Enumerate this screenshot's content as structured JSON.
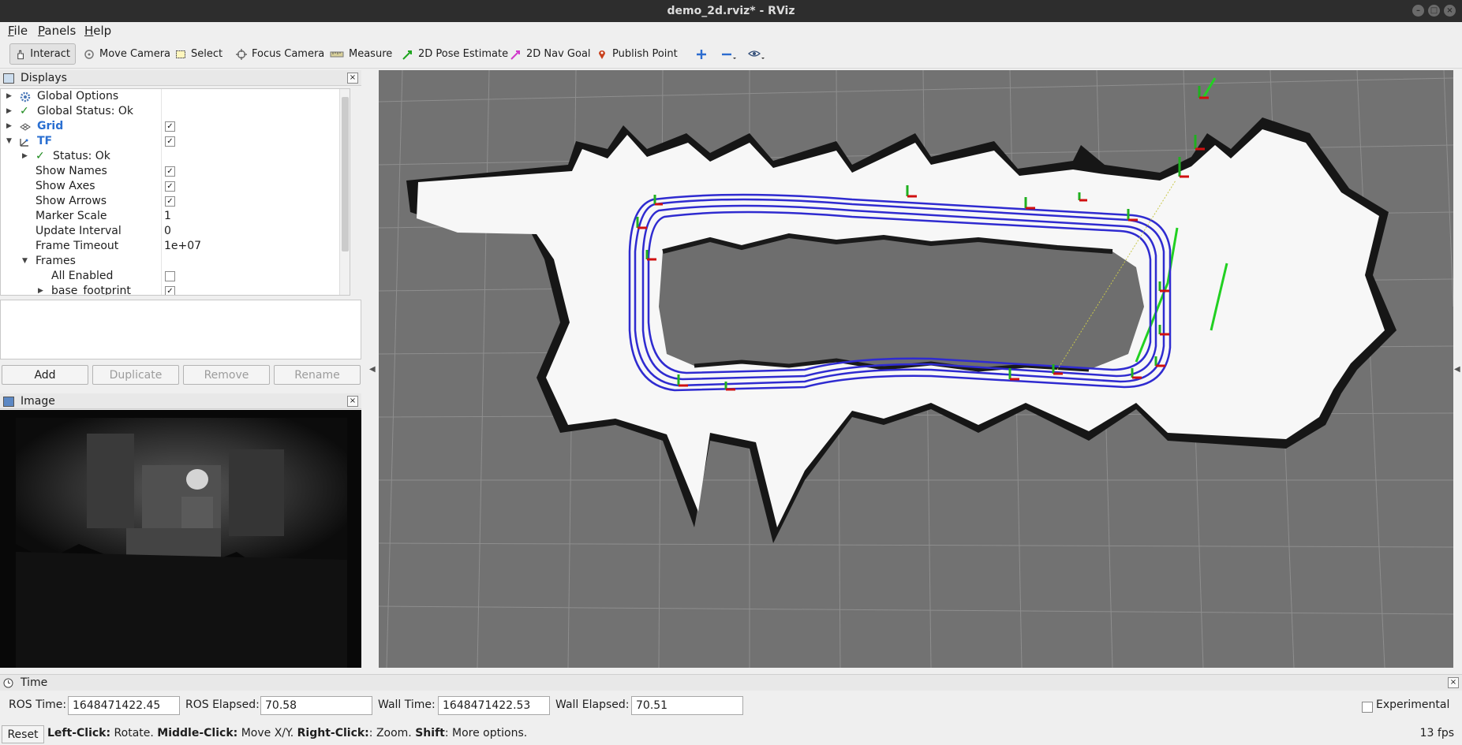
{
  "window": {
    "title": "demo_2d.rviz* - RViz"
  },
  "menu": [
    {
      "label": "File",
      "mnemonic": "F",
      "rest": "ile"
    },
    {
      "label": "Panels",
      "mnemonic": "P",
      "rest": "anels"
    },
    {
      "label": "Help",
      "mnemonic": "H",
      "rest": "elp"
    }
  ],
  "toolbar": {
    "interact": "Interact",
    "move_camera": "Move Camera",
    "select": "Select",
    "focus_camera": "Focus Camera",
    "measure": "Measure",
    "pose_estimate": "2D Pose Estimate",
    "nav_goal": "2D Nav Goal",
    "publish_point": "Publish Point"
  },
  "displays": {
    "title": "Displays",
    "rows": [
      {
        "label": "Global Options",
        "value": ""
      },
      {
        "label": "Global Status: Ok",
        "value": ""
      },
      {
        "label": "Grid",
        "value": ""
      },
      {
        "label": "TF",
        "value": ""
      },
      {
        "label": "Status: Ok",
        "value": ""
      },
      {
        "label": "Show Names",
        "value": ""
      },
      {
        "label": "Show Axes",
        "value": ""
      },
      {
        "label": "Show Arrows",
        "value": ""
      },
      {
        "label": "Marker Scale",
        "value": "1"
      },
      {
        "label": "Update Interval",
        "value": "0"
      },
      {
        "label": "Frame Timeout",
        "value": "1e+07"
      },
      {
        "label": "Frames",
        "value": ""
      },
      {
        "label": "All Enabled",
        "value": ""
      },
      {
        "label": "base_footprint",
        "value": ""
      }
    ],
    "checkboxes": {
      "grid": true,
      "tf": true,
      "show_names": true,
      "show_axes": true,
      "show_arrows": true,
      "all_enabled": false,
      "base_footprint": true
    },
    "buttons": {
      "add": "Add",
      "duplicate": "Duplicate",
      "remove": "Remove",
      "rename": "Rename"
    }
  },
  "image_panel": {
    "title": "Image"
  },
  "time_panel": {
    "title": "Time",
    "ros_time_label": "ROS Time:",
    "ros_time": "1648471422.45",
    "ros_elapsed_label": "ROS Elapsed:",
    "ros_elapsed": "70.58",
    "wall_time_label": "Wall Time:",
    "wall_time": "1648471422.53",
    "wall_elapsed_label": "Wall Elapsed:",
    "wall_elapsed": "70.51",
    "experimental_label": "Experimental"
  },
  "status": {
    "reset": "Reset",
    "left_click_key": "Left-Click:",
    "left_click_desc": " Rotate. ",
    "middle_click_key": "Middle-Click:",
    "middle_click_desc": " Move X/Y. ",
    "right_click_key": "Right-Click:",
    "right_click_desc": ": Zoom. ",
    "shift_key": "Shift",
    "shift_desc": ": More options.",
    "fps": "13 fps"
  },
  "colors": {
    "path": "#2f2bd0",
    "titlebar": "#2d2d2d",
    "viewport_bg": "#737373",
    "link_blue": "#2a6fd1"
  }
}
